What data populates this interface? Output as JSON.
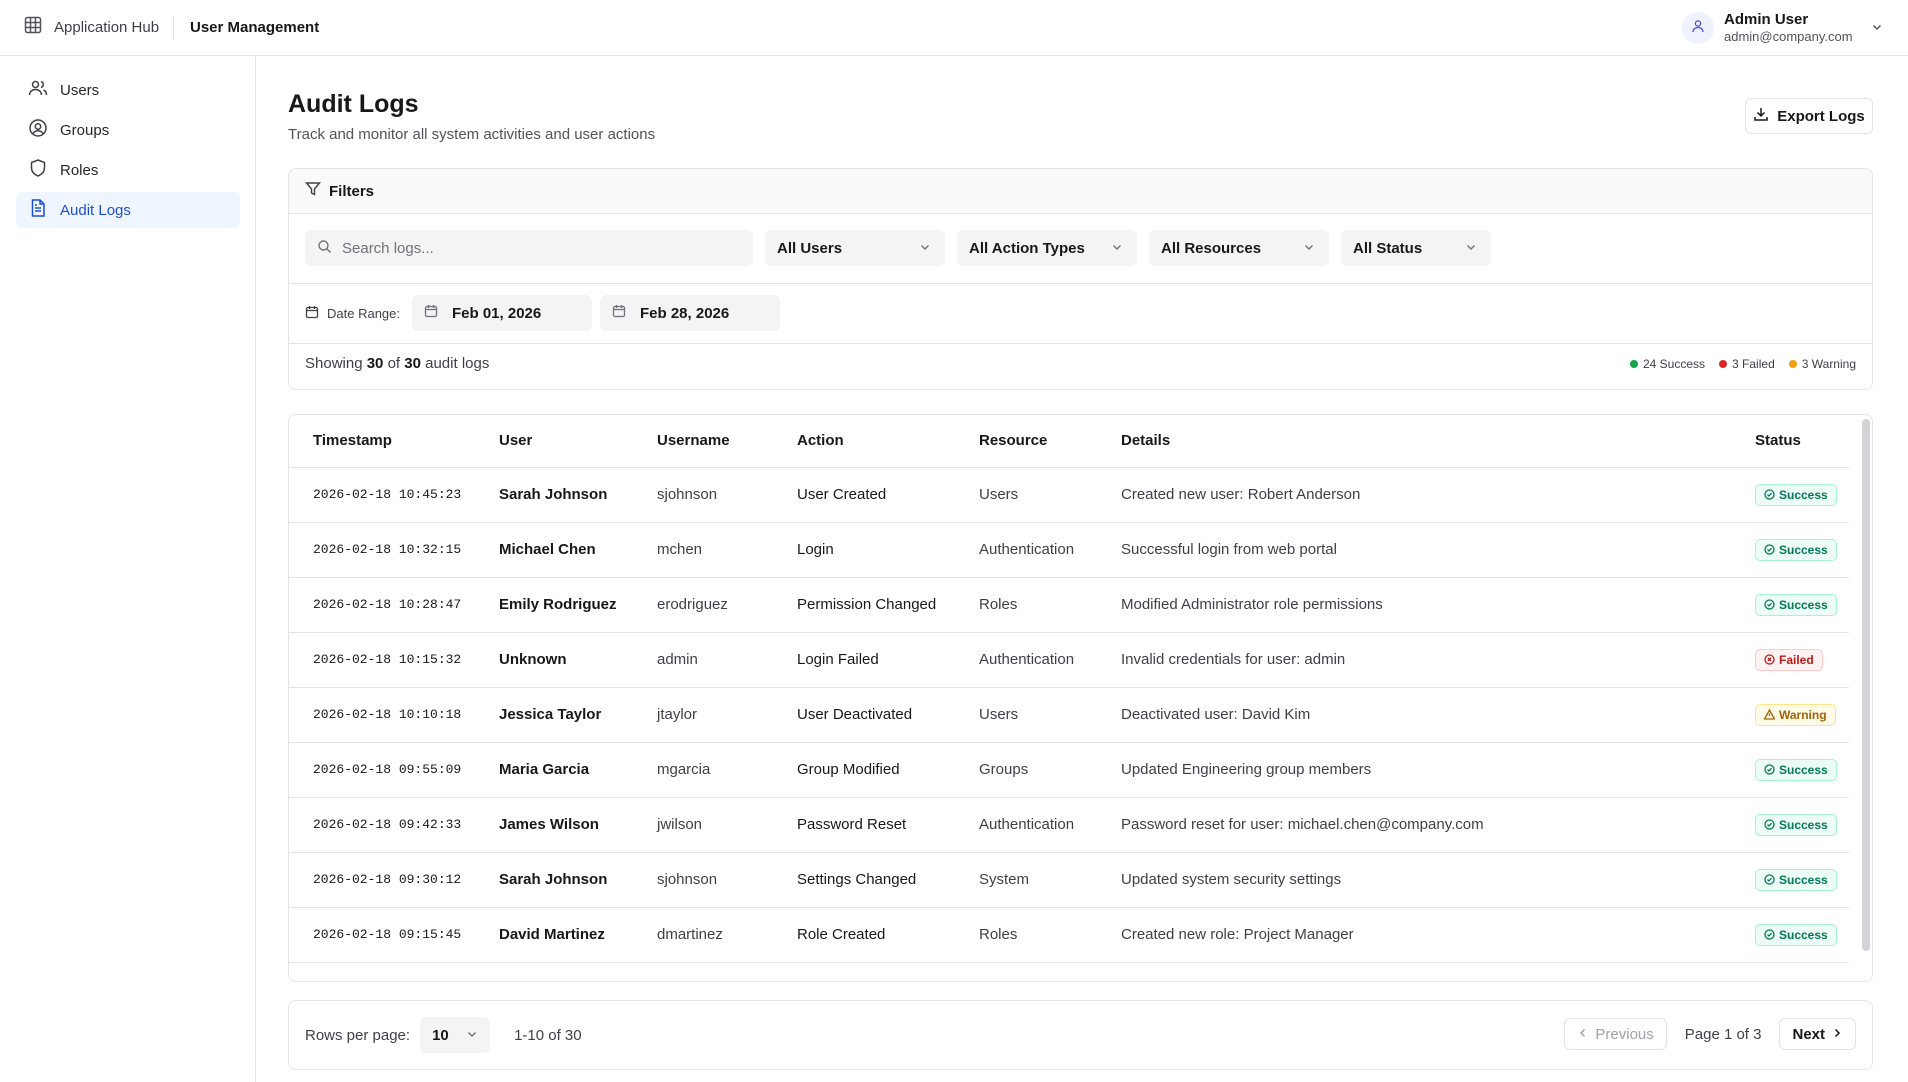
{
  "topbar": {
    "app_title": "Application Hub",
    "section_title": "User Management",
    "user_name": "Admin User",
    "user_email": "admin@company.com"
  },
  "sidebar": {
    "items": [
      {
        "label": "Users",
        "icon": "users-icon",
        "active": false
      },
      {
        "label": "Groups",
        "icon": "user-circle-icon",
        "active": false
      },
      {
        "label": "Roles",
        "icon": "shield-icon",
        "active": false
      },
      {
        "label": "Audit Logs",
        "icon": "document-icon",
        "active": true
      }
    ]
  },
  "page": {
    "title": "Audit Logs",
    "subtitle": "Track and monitor all system activities and user actions",
    "export_label": "Export Logs"
  },
  "filters": {
    "title": "Filters",
    "search_placeholder": "Search logs...",
    "user_select": "All Users",
    "action_select": "All Action Types",
    "resource_select": "All Resources",
    "status_select": "All Status",
    "date_range_label": "Date Range:",
    "date_from": "Feb 01, 2026",
    "date_to": "Feb 28, 2026"
  },
  "summary": {
    "showing_prefix": "Showing",
    "shown": "30",
    "of": "of",
    "total": "30",
    "suffix": "audit logs",
    "success": "24 Success",
    "failed": "3 Failed",
    "warning": "3 Warning",
    "colors": {
      "success": "#16a34a",
      "failed": "#dc2626",
      "warning": "#f59e0b"
    }
  },
  "table": {
    "headers": {
      "timestamp": "Timestamp",
      "user": "User",
      "username": "Username",
      "action": "Action",
      "resource": "Resource",
      "details": "Details",
      "status": "Status"
    },
    "rows": [
      {
        "timestamp": "2026-02-18 10:45:23",
        "user": "Sarah Johnson",
        "username": "sjohnson",
        "action": "User Created",
        "resource": "Users",
        "details": "Created new user: Robert Anderson",
        "status": "Success"
      },
      {
        "timestamp": "2026-02-18 10:32:15",
        "user": "Michael Chen",
        "username": "mchen",
        "action": "Login",
        "resource": "Authentication",
        "details": "Successful login from web portal",
        "status": "Success"
      },
      {
        "timestamp": "2026-02-18 10:28:47",
        "user": "Emily Rodriguez",
        "username": "erodriguez",
        "action": "Permission Changed",
        "resource": "Roles",
        "details": "Modified Administrator role permissions",
        "status": "Success"
      },
      {
        "timestamp": "2026-02-18 10:15:32",
        "user": "Unknown",
        "username": "admin",
        "action": "Login Failed",
        "resource": "Authentication",
        "details": "Invalid credentials for user: admin",
        "status": "Failed"
      },
      {
        "timestamp": "2026-02-18 10:10:18",
        "user": "Jessica Taylor",
        "username": "jtaylor",
        "action": "User Deactivated",
        "resource": "Users",
        "details": "Deactivated user: David Kim",
        "status": "Warning"
      },
      {
        "timestamp": "2026-02-18 09:55:09",
        "user": "Maria Garcia",
        "username": "mgarcia",
        "action": "Group Modified",
        "resource": "Groups",
        "details": "Updated Engineering group members",
        "status": "Success"
      },
      {
        "timestamp": "2026-02-18 09:42:33",
        "user": "James Wilson",
        "username": "jwilson",
        "action": "Password Reset",
        "resource": "Authentication",
        "details": "Password reset for user: michael.chen@company.com",
        "status": "Success"
      },
      {
        "timestamp": "2026-02-18 09:30:12",
        "user": "Sarah Johnson",
        "username": "sjohnson",
        "action": "Settings Changed",
        "resource": "System",
        "details": "Updated system security settings",
        "status": "Success"
      },
      {
        "timestamp": "2026-02-18 09:15:45",
        "user": "David Martinez",
        "username": "dmartinez",
        "action": "Role Created",
        "resource": "Roles",
        "details": "Created new role: Project Manager",
        "status": "Success"
      }
    ]
  },
  "pagination": {
    "rows_label": "Rows per page:",
    "rows_value": "10",
    "range": "1-10 of 30",
    "previous": "Previous",
    "page_info": "Page 1 of 3",
    "next": "Next"
  }
}
